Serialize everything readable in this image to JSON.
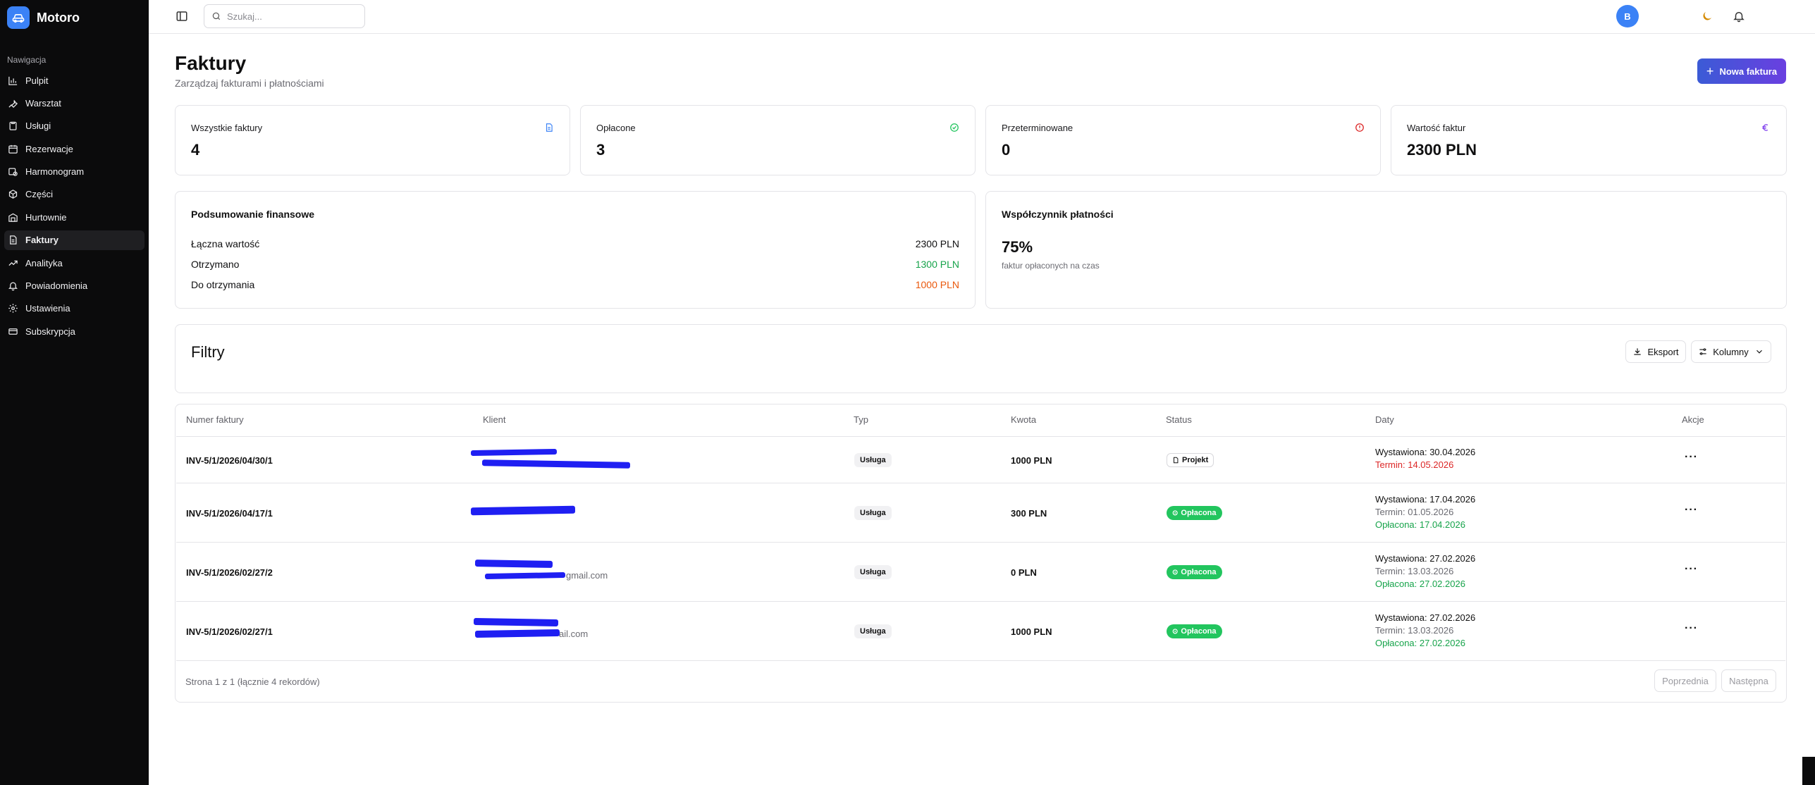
{
  "app": {
    "name": "Motoro"
  },
  "sidebar": {
    "section_title": "Nawigacja",
    "items": [
      {
        "label": "Pulpit",
        "icon": "chart-icon"
      },
      {
        "label": "Warsztat",
        "icon": "wrench-icon"
      },
      {
        "label": "Usługi",
        "icon": "clipboard-icon"
      },
      {
        "label": "Rezerwacje",
        "icon": "calendar-icon"
      },
      {
        "label": "Harmonogram",
        "icon": "calendar-clock-icon"
      },
      {
        "label": "Części",
        "icon": "package-icon"
      },
      {
        "label": "Hurtownie",
        "icon": "warehouse-icon"
      },
      {
        "label": "Faktury",
        "icon": "file-icon",
        "active": true
      },
      {
        "label": "Analityka",
        "icon": "trending-icon"
      },
      {
        "label": "Powiadomienia",
        "icon": "bell-icon"
      },
      {
        "label": "Ustawienia",
        "icon": "gear-icon"
      },
      {
        "label": "Subskrypcja",
        "icon": "card-icon"
      }
    ]
  },
  "topbar": {
    "search_placeholder": "Szukaj...",
    "avatar_initial": "B"
  },
  "page": {
    "title": "Faktury",
    "subtitle": "Zarządzaj fakturami i płatnościami",
    "new_button": "Nowa faktura"
  },
  "stats": [
    {
      "label": "Wszystkie faktury",
      "value": "4",
      "icon": "document-icon",
      "color": "#3b82f6"
    },
    {
      "label": "Opłacone",
      "value": "3",
      "icon": "check-circle-icon",
      "color": "#22c55e"
    },
    {
      "label": "Przeterminowane",
      "value": "0",
      "icon": "alert-circle-icon",
      "color": "#dc2626"
    },
    {
      "label": "Wartość faktur",
      "value": "2300 PLN",
      "icon": "euro-icon",
      "color": "#7c3aed"
    }
  ],
  "summary": {
    "title": "Podsumowanie finansowe",
    "rows": [
      {
        "label": "Łączna wartość",
        "value": "2300 PLN"
      },
      {
        "label": "Otrzymano",
        "value": "1300 PLN"
      },
      {
        "label": "Do otrzymania",
        "value": "1000 PLN"
      }
    ]
  },
  "rate": {
    "title": "Współczynnik płatności",
    "value": "75%",
    "subtitle": "faktur opłaconych na czas"
  },
  "filters": {
    "title": "Filtry",
    "export_label": "Eksport",
    "columns_label": "Kolumny"
  },
  "table": {
    "headers": [
      "Numer faktury",
      "Klient",
      "Typ",
      "Kwota",
      "Status",
      "Daty",
      "Akcje"
    ],
    "rows": [
      {
        "number": "INV-5/1/2026/04/30/1",
        "email": "",
        "type": "Usługa",
        "amount": "1000 PLN",
        "status": "Projekt",
        "issued": "Wystawiona: 30.04.2026",
        "due": "Termin: 14.05.2026",
        "paid": ""
      },
      {
        "number": "INV-5/1/2026/04/17/1",
        "email": "",
        "type": "Usługa",
        "amount": "300 PLN",
        "status": "Opłacona",
        "issued": "Wystawiona: 17.04.2026",
        "due": "Termin: 01.05.2026",
        "paid": "Opłacona: 17.04.2026"
      },
      {
        "number": "INV-5/1/2026/02/27/2",
        "email": "gmail.com",
        "type": "Usługa",
        "amount": "0 PLN",
        "status": "Opłacona",
        "issued": "Wystawiona: 27.02.2026",
        "due": "Termin: 13.03.2026",
        "paid": "Opłacona: 27.02.2026"
      },
      {
        "number": "INV-5/1/2026/02/27/1",
        "email": "ail.com",
        "type": "Usługa",
        "amount": "1000 PLN",
        "status": "Opłacona",
        "issued": "Wystawiona: 27.02.2026",
        "due": "Termin: 13.03.2026",
        "paid": "Opłacona: 27.02.2026"
      }
    ]
  },
  "pagination": {
    "info": "Strona 1 z 1 (łącznie 4 rekordów)",
    "prev": "Poprzednia",
    "next": "Następna"
  }
}
